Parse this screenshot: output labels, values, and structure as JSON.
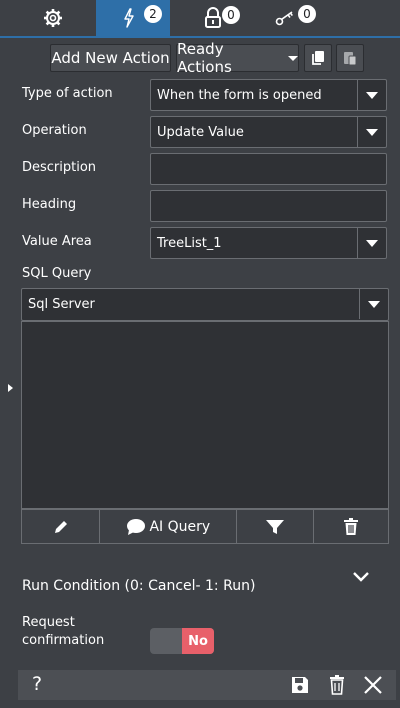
{
  "tabs": {
    "settings_icon": "gear-icon",
    "actions_icon": "lightning-icon",
    "actions_count": "2",
    "lock_count": "0",
    "key_count": "0"
  },
  "toolbar": {
    "add_new_action": "Add New Action",
    "ready_actions": "Ready Actions"
  },
  "form": {
    "type_of_action_label": "Type of action",
    "type_of_action_value": "When the form is opened",
    "operation_label": "Operation",
    "operation_value": "Update Value",
    "description_label": "Description",
    "description_value": "",
    "heading_label": "Heading",
    "heading_value": "",
    "value_area_label": "Value Area",
    "value_area_value": "TreeList_1",
    "sql_query_label": "SQL Query",
    "sql_db_value": "Sql Server",
    "sql_query_text": ""
  },
  "query_tools": {
    "ai_query_label": "AI Query"
  },
  "run_condition": {
    "label": "Run Condition (0: Cancel- 1: Run)"
  },
  "request_confirmation": {
    "label_line1": "Request",
    "label_line2": "confirmation",
    "toggle_value": "No"
  },
  "footer": {
    "help_label": "?"
  },
  "colors": {
    "background": "#3d4045",
    "active_tab": "#2e6fa8",
    "toggle_no": "#e8606a"
  }
}
